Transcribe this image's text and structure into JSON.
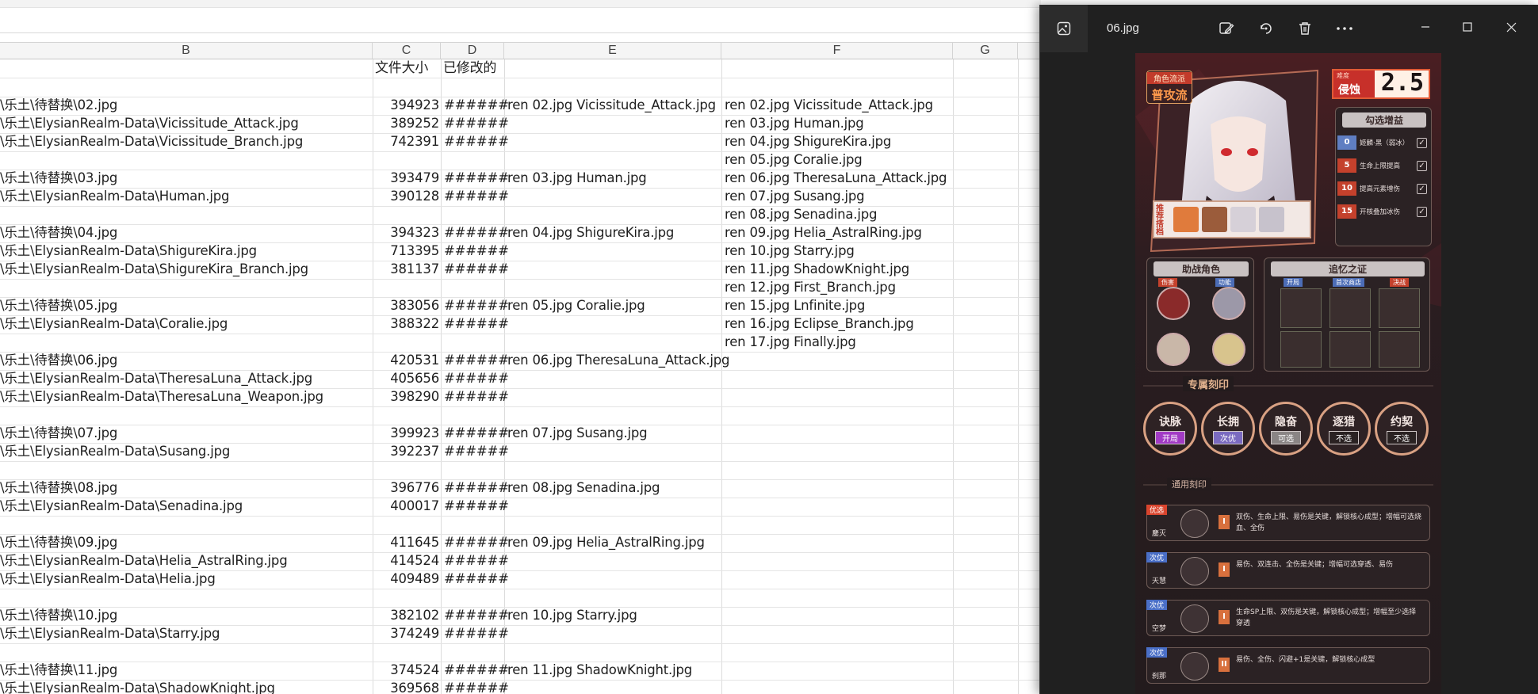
{
  "sheet": {
    "columns": [
      "B",
      "C",
      "D",
      "E",
      "F",
      "G"
    ],
    "header_row": {
      "size": "文件大小",
      "modified": "已修改的"
    },
    "rows": [
      {
        "b": "\\乐土\\待替换\\02.jpg",
        "c": "394923",
        "d": "######",
        "e": "ren 02.jpg Vicissitude_Attack.jpg",
        "f": "ren 02.jpg Vicissitude_Attack.jpg"
      },
      {
        "b": "\\乐土\\ElysianRealm-Data\\Vicissitude_Attack.jpg",
        "c": "389252",
        "d": "######",
        "e": "",
        "f": "ren 03.jpg Human.jpg"
      },
      {
        "b": "\\乐土\\ElysianRealm-Data\\Vicissitude_Branch.jpg",
        "c": "742391",
        "d": "######",
        "e": "",
        "f": "ren 04.jpg ShigureKira.jpg"
      },
      {
        "b": "",
        "c": "",
        "d": "",
        "e": "",
        "f": "ren 05.jpg Coralie.jpg"
      },
      {
        "b": "\\乐土\\待替换\\03.jpg",
        "c": "393479",
        "d": "######",
        "e": "ren 03.jpg Human.jpg",
        "f": "ren 06.jpg TheresaLuna_Attack.jpg"
      },
      {
        "b": "\\乐土\\ElysianRealm-Data\\Human.jpg",
        "c": "390128",
        "d": "######",
        "e": "",
        "f": "ren 07.jpg Susang.jpg"
      },
      {
        "b": "",
        "c": "",
        "d": "",
        "e": "",
        "f": "ren 08.jpg Senadina.jpg"
      },
      {
        "b": "\\乐土\\待替换\\04.jpg",
        "c": "394323",
        "d": "######",
        "e": "ren 04.jpg ShigureKira.jpg",
        "f": "ren 09.jpg Helia_AstralRing.jpg"
      },
      {
        "b": "\\乐土\\ElysianRealm-Data\\ShigureKira.jpg",
        "c": "713395",
        "d": "######",
        "e": "",
        "f": "ren 10.jpg Starry.jpg"
      },
      {
        "b": "\\乐土\\ElysianRealm-Data\\ShigureKira_Branch.jpg",
        "c": "381137",
        "d": "######",
        "e": "",
        "f": "ren 11.jpg ShadowKnight.jpg"
      },
      {
        "b": "",
        "c": "",
        "d": "",
        "e": "",
        "f": "ren 12.jpg First_Branch.jpg"
      },
      {
        "b": "\\乐土\\待替换\\05.jpg",
        "c": "383056",
        "d": "######",
        "e": "ren 05.jpg Coralie.jpg",
        "f": "ren 15.jpg Lnfinite.jpg"
      },
      {
        "b": "\\乐土\\ElysianRealm-Data\\Coralie.jpg",
        "c": "388322",
        "d": "######",
        "e": "",
        "f": "ren 16.jpg Eclipse_Branch.jpg"
      },
      {
        "b": "",
        "c": "",
        "d": "",
        "e": "",
        "f": "ren 17.jpg Finally.jpg"
      },
      {
        "b": "\\乐土\\待替换\\06.jpg",
        "c": "420531",
        "d": "######",
        "e": "ren 06.jpg TheresaLuna_Attack.jpg",
        "f": ""
      },
      {
        "b": "\\乐土\\ElysianRealm-Data\\TheresaLuna_Attack.jpg",
        "c": "405656",
        "d": "######",
        "e": "",
        "f": ""
      },
      {
        "b": "\\乐土\\ElysianRealm-Data\\TheresaLuna_Weapon.jpg",
        "c": "398290",
        "d": "######",
        "e": "",
        "f": ""
      },
      {
        "b": "",
        "c": "",
        "d": "",
        "e": "",
        "f": ""
      },
      {
        "b": "\\乐土\\待替换\\07.jpg",
        "c": "399923",
        "d": "######",
        "e": "ren 07.jpg Susang.jpg",
        "f": ""
      },
      {
        "b": "\\乐土\\ElysianRealm-Data\\Susang.jpg",
        "c": "392237",
        "d": "######",
        "e": "",
        "f": ""
      },
      {
        "b": "",
        "c": "",
        "d": "",
        "e": "",
        "f": ""
      },
      {
        "b": "\\乐土\\待替换\\08.jpg",
        "c": "396776",
        "d": "######",
        "e": "ren 08.jpg Senadina.jpg",
        "f": ""
      },
      {
        "b": "\\乐土\\ElysianRealm-Data\\Senadina.jpg",
        "c": "400017",
        "d": "######",
        "e": "",
        "f": ""
      },
      {
        "b": "",
        "c": "",
        "d": "",
        "e": "",
        "f": ""
      },
      {
        "b": "\\乐土\\待替换\\09.jpg",
        "c": "411645",
        "d": "######",
        "e": "ren 09.jpg Helia_AstralRing.jpg",
        "f": ""
      },
      {
        "b": "\\乐土\\ElysianRealm-Data\\Helia_AstralRing.jpg",
        "c": "414524",
        "d": "######",
        "e": "",
        "f": ""
      },
      {
        "b": "\\乐土\\ElysianRealm-Data\\Helia.jpg",
        "c": "409489",
        "d": "######",
        "e": "",
        "f": ""
      },
      {
        "b": "",
        "c": "",
        "d": "",
        "e": "",
        "f": ""
      },
      {
        "b": "\\乐土\\待替换\\10.jpg",
        "c": "382102",
        "d": "######",
        "e": "ren 10.jpg Starry.jpg",
        "f": ""
      },
      {
        "b": "\\乐土\\ElysianRealm-Data\\Starry.jpg",
        "c": "374249",
        "d": "######",
        "e": "",
        "f": ""
      },
      {
        "b": "",
        "c": "",
        "d": "",
        "e": "",
        "f": ""
      },
      {
        "b": "\\乐土\\待替换\\11.jpg",
        "c": "374524",
        "d": "######",
        "e": "ren 11.jpg ShadowKnight.jpg",
        "f": ""
      },
      {
        "b": "\\乐土\\ElysianRealm-Data\\ShadowKnight.jpg",
        "c": "369568",
        "d": "######",
        "e": "",
        "f": ""
      }
    ]
  },
  "viewer": {
    "file_name": "06.jpg",
    "toolbar_icons": [
      "edit-image-icon",
      "rotate-icon",
      "delete-icon",
      "more-icon"
    ],
    "window_controls": [
      "minimize-icon",
      "maximize-icon",
      "close-icon"
    ]
  },
  "card": {
    "style_tag": "角色流派",
    "style_value": "普攻流",
    "difficulty_label": "难度",
    "difficulty_name": "侵蚀",
    "difficulty_value": "2.5",
    "recommend_label": "推荐搭档",
    "bonus_title": "勾选增益",
    "bonuses": [
      {
        "num": "0",
        "text": "姬麟·黑（弱冰）"
      },
      {
        "num": "5",
        "text": "生命上限提高"
      },
      {
        "num": "10",
        "text": "提高元素增伤"
      },
      {
        "num": "15",
        "text": "开核叠加冰伤"
      }
    ],
    "support_title": "助战角色",
    "support_tags": [
      "伤害",
      "功能"
    ],
    "memory_title": "追忆之证",
    "memory_tags": [
      "开局",
      "首次商店",
      "决战"
    ],
    "exclusive_title": "专属刻印",
    "exclusive": [
      {
        "name": "诀脉",
        "tag": "开局",
        "color": "#a23bc5"
      },
      {
        "name": "长拥",
        "tag": "次优",
        "color": "#7a6ac0"
      },
      {
        "name": "隐奋",
        "tag": "可选",
        "color": "#8a8585"
      },
      {
        "name": "逐猎",
        "tag": "不选",
        "color": "#2a2222"
      },
      {
        "name": "约契",
        "tag": "不选",
        "color": "#2a2222"
      }
    ],
    "general_title": "通用刻印",
    "general": [
      {
        "rank": "优选",
        "rank_color": "#d9452e",
        "name": "鏖灭",
        "level": "I",
        "desc": "双伤、生命上限、易伤是关键，解锁核心成型；增幅可选烧血、全伤"
      },
      {
        "rank": "次优",
        "rank_color": "#4a6fc7",
        "name": "天慧",
        "level": "I",
        "desc": "易伤、双连击、全伤是关键；增幅可选穿透、易伤"
      },
      {
        "rank": "次优",
        "rank_color": "#4a6fc7",
        "name": "空梦",
        "level": "I",
        "desc": "生命SP上限、双伤是关键，解锁核心成型；增幅至少选择穿透"
      },
      {
        "rank": "次优",
        "rank_color": "#4a6fc7",
        "name": "刹那",
        "level": "II",
        "desc": "易伤、全伤、闪避+1是关键，解锁核心成型"
      }
    ]
  }
}
